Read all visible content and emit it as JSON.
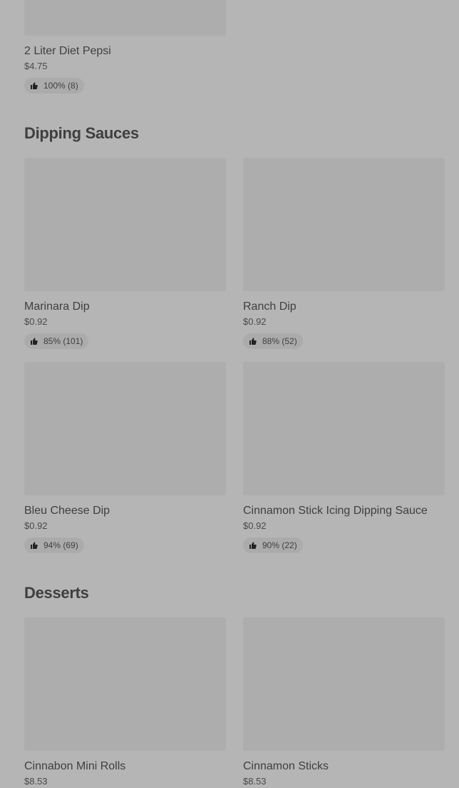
{
  "top_item": {
    "name": "2 Liter Diet Pepsi",
    "price": "$4.75",
    "rating": "100% (8)"
  },
  "sections": [
    {
      "title": "Dipping Sauces",
      "items": [
        {
          "name": "Marinara Dip",
          "price": "$0.92",
          "rating": "85% (101)"
        },
        {
          "name": "Ranch Dip",
          "price": "$0.92",
          "rating": "88% (52)"
        },
        {
          "name": "Bleu Cheese Dip",
          "price": "$0.92",
          "rating": "94% (69)"
        },
        {
          "name": "Cinnamon Stick Icing Dipping Sauce",
          "price": "$0.92",
          "rating": "90% (22)"
        }
      ]
    },
    {
      "title": "Desserts",
      "items": [
        {
          "name": "Cinnabon Mini Rolls",
          "price": "$8.53"
        },
        {
          "name": "Cinnamon Sticks",
          "price": "$8.53"
        }
      ]
    }
  ],
  "icons": {
    "rating": "thumbs-up-icon"
  },
  "colors": {
    "background": "#b5b5b5",
    "image_placeholder": "#adadad",
    "rating_pill": "#ababab",
    "text": "#3f3f3f"
  }
}
